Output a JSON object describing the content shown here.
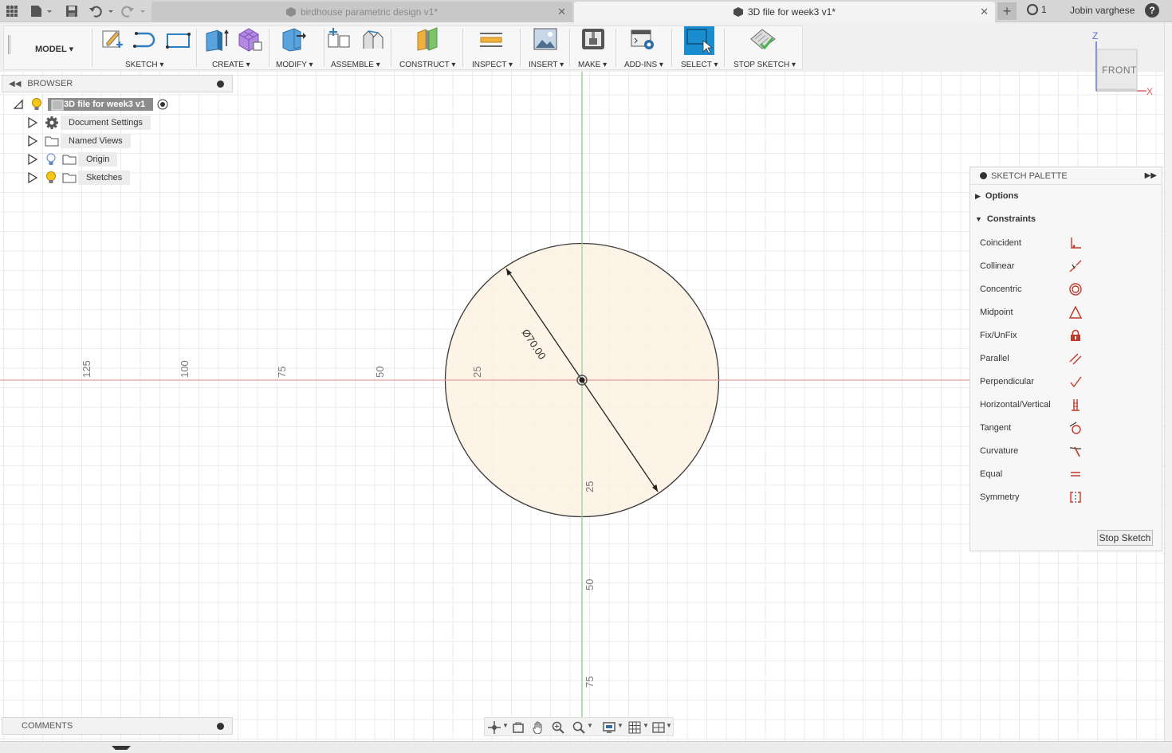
{
  "titlebar": {
    "tabs": [
      {
        "label": "birdhouse parametric design v1*",
        "active": false
      },
      {
        "label": "3D file for week3 v1*",
        "active": true
      }
    ],
    "job_count": "1",
    "user": "Jobin varghese",
    "help": "?"
  },
  "toolbar": {
    "workspace": "MODEL",
    "groups": [
      "SKETCH",
      "CREATE",
      "MODIFY",
      "ASSEMBLE",
      "CONSTRUCT",
      "INSPECT",
      "INSERT",
      "MAKE",
      "ADD-INS",
      "SELECT",
      "STOP SKETCH"
    ]
  },
  "browser": {
    "title": "BROWSER",
    "root": "3D file for week3 v1",
    "items": [
      "Document Settings",
      "Named Views",
      "Origin",
      "Sketches"
    ]
  },
  "canvas": {
    "h_axis_labels": [
      "125",
      "100",
      "75",
      "50",
      "25"
    ],
    "v_axis_labels": [
      "25",
      "50",
      "75"
    ],
    "dimension": "Ø70.00"
  },
  "viewcube": {
    "face": "FRONT",
    "z": "Z",
    "x": "X"
  },
  "palette": {
    "title": "SKETCH PALETTE",
    "options": "Options",
    "constraints_title": "Constraints",
    "constraints": [
      "Coincident",
      "Collinear",
      "Concentric",
      "Midpoint",
      "Fix/UnFix",
      "Parallel",
      "Perpendicular",
      "Horizontal/Vertical",
      "Tangent",
      "Curvature",
      "Equal",
      "Symmetry"
    ],
    "stop_button": "Stop Sketch"
  },
  "comments": {
    "title": "COMMENTS"
  },
  "colors": {
    "x_axis": "#e8a0a0",
    "y_axis": "#8fd18f",
    "profile_fill": "#fdf1e2",
    "constraint_red": "#c0392b",
    "select_blue": "#1a8dd0"
  }
}
